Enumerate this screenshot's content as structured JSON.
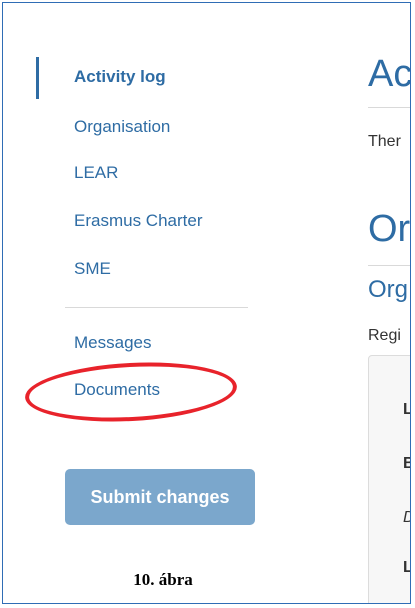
{
  "sidebar": {
    "items": [
      {
        "label": "Activity log",
        "active": true
      },
      {
        "label": "Organisation"
      },
      {
        "label": "LEAR"
      },
      {
        "label": "Erasmus Charter"
      },
      {
        "label": "SME"
      }
    ],
    "secondary_items": [
      {
        "label": "Messages"
      },
      {
        "label": "Documents"
      }
    ],
    "submit_label": "Submit changes"
  },
  "caption": "10. ábra",
  "main": {
    "heading1": "Ac",
    "text1": "Ther",
    "heading2": "Or",
    "subheading": "Org",
    "text2": "Regi",
    "panel_lines": [
      "Lo",
      "B",
      "D",
      "Lo"
    ]
  },
  "colors": {
    "accent": "#2e6ca4",
    "button": "#7ba7cc",
    "annotation": "#e8232b",
    "frame": "#2f6db5"
  }
}
